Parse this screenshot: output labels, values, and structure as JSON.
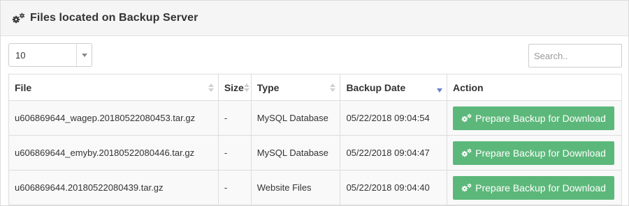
{
  "panel": {
    "title": "Files located on Backup Server"
  },
  "controls": {
    "page_length": "10",
    "search_placeholder": "Search.."
  },
  "table": {
    "headers": {
      "file": "File",
      "size": "Size",
      "type": "Type",
      "backup_date": "Backup Date",
      "action": "Action"
    },
    "sort": {
      "column": "backup_date",
      "direction": "descending"
    },
    "rows": [
      {
        "file": "u606869644_wagep.20180522080453.tar.gz",
        "size": "-",
        "type": "MySQL Database",
        "backup_date": "05/22/2018 09:04:54",
        "action": "Prepare Backup for Download"
      },
      {
        "file": "u606869644_emyby.20180522080446.tar.gz",
        "size": "-",
        "type": "MySQL Database",
        "backup_date": "05/22/2018 09:04:47",
        "action": "Prepare Backup for Download"
      },
      {
        "file": "u606869644.20180522080439.tar.gz",
        "size": "-",
        "type": "Website Files",
        "backup_date": "05/22/2018 09:04:40",
        "action": "Prepare Backup for Download"
      }
    ]
  },
  "icons": {
    "header": "gears-icon",
    "button": "gears-icon"
  },
  "colors": {
    "button": "#5cb87a",
    "sort_active": "#6d7fcc",
    "header_bg": "#f5f5f5"
  }
}
